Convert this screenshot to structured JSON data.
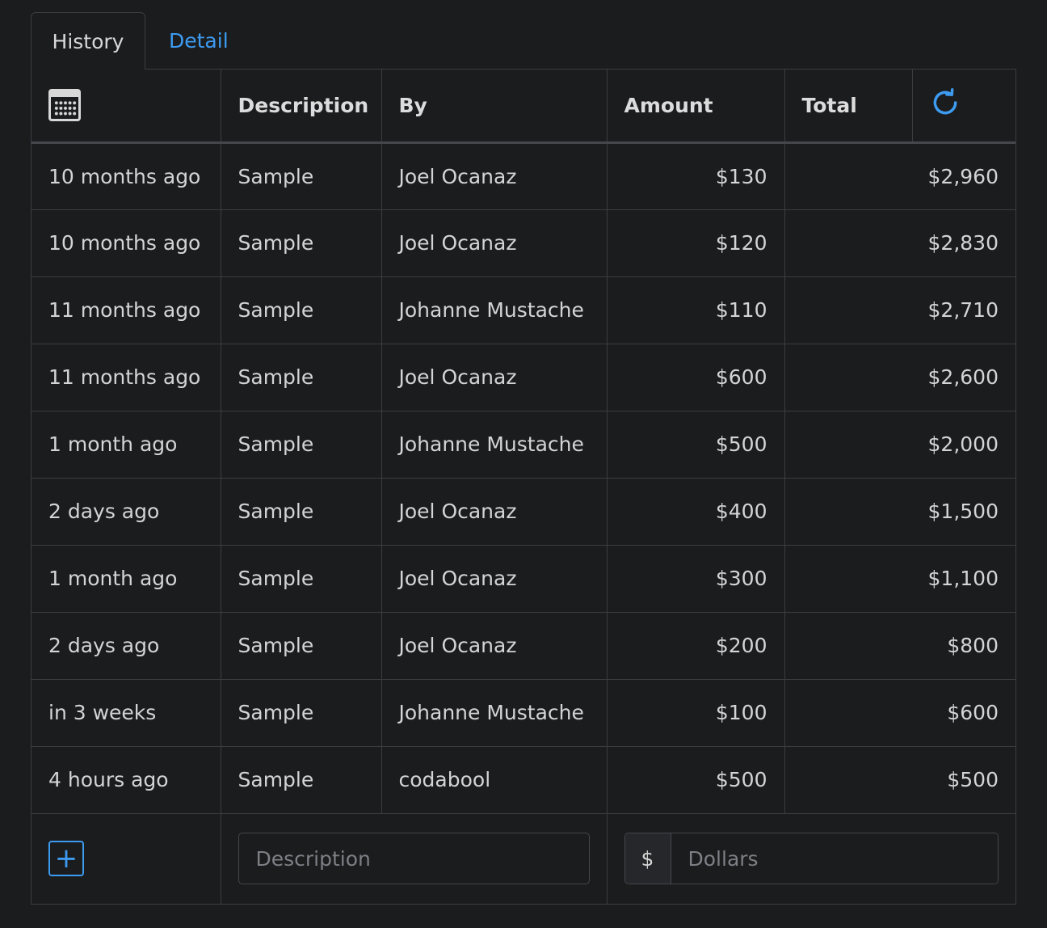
{
  "tabs": [
    {
      "label": "History",
      "active": true
    },
    {
      "label": "Detail",
      "active": false
    }
  ],
  "columns": {
    "date_icon": "calendar-icon",
    "description": "Description",
    "by": "By",
    "amount": "Amount",
    "total": "Total",
    "refresh_icon": "refresh-icon"
  },
  "rows": [
    {
      "when": "10 months ago",
      "description": "Sample",
      "by": "Joel Ocanaz",
      "amount": "$130",
      "total": "$2,960"
    },
    {
      "when": "10 months ago",
      "description": "Sample",
      "by": "Joel Ocanaz",
      "amount": "$120",
      "total": "$2,830"
    },
    {
      "when": "11 months ago",
      "description": "Sample",
      "by": "Johanne Mustache",
      "amount": "$110",
      "total": "$2,710"
    },
    {
      "when": "11 months ago",
      "description": "Sample",
      "by": "Joel Ocanaz",
      "amount": "$600",
      "total": "$2,600"
    },
    {
      "when": "1 month ago",
      "description": "Sample",
      "by": "Johanne Mustache",
      "amount": "$500",
      "total": "$2,000"
    },
    {
      "when": "2 days ago",
      "description": "Sample",
      "by": "Joel Ocanaz",
      "amount": "$400",
      "total": "$1,500"
    },
    {
      "when": "1 month ago",
      "description": "Sample",
      "by": "Joel Ocanaz",
      "amount": "$300",
      "total": "$1,100"
    },
    {
      "when": "2 days ago",
      "description": "Sample",
      "by": "Joel Ocanaz",
      "amount": "$200",
      "total": "$800"
    },
    {
      "when": "in 3 weeks",
      "description": "Sample",
      "by": "Johanne Mustache",
      "amount": "$100",
      "total": "$600"
    },
    {
      "when": "4 hours ago",
      "description": "Sample",
      "by": "codabool",
      "amount": "$500",
      "total": "$500"
    }
  ],
  "footer": {
    "add_label": "+",
    "description_placeholder": "Description",
    "description_value": "",
    "currency_symbol": "$",
    "dollars_placeholder": "Dollars",
    "dollars_value": ""
  },
  "colors": {
    "background": "#1b1c1e",
    "border": "#3a3d42",
    "accent": "#3d9bf0",
    "text": "#d4d4d4"
  }
}
